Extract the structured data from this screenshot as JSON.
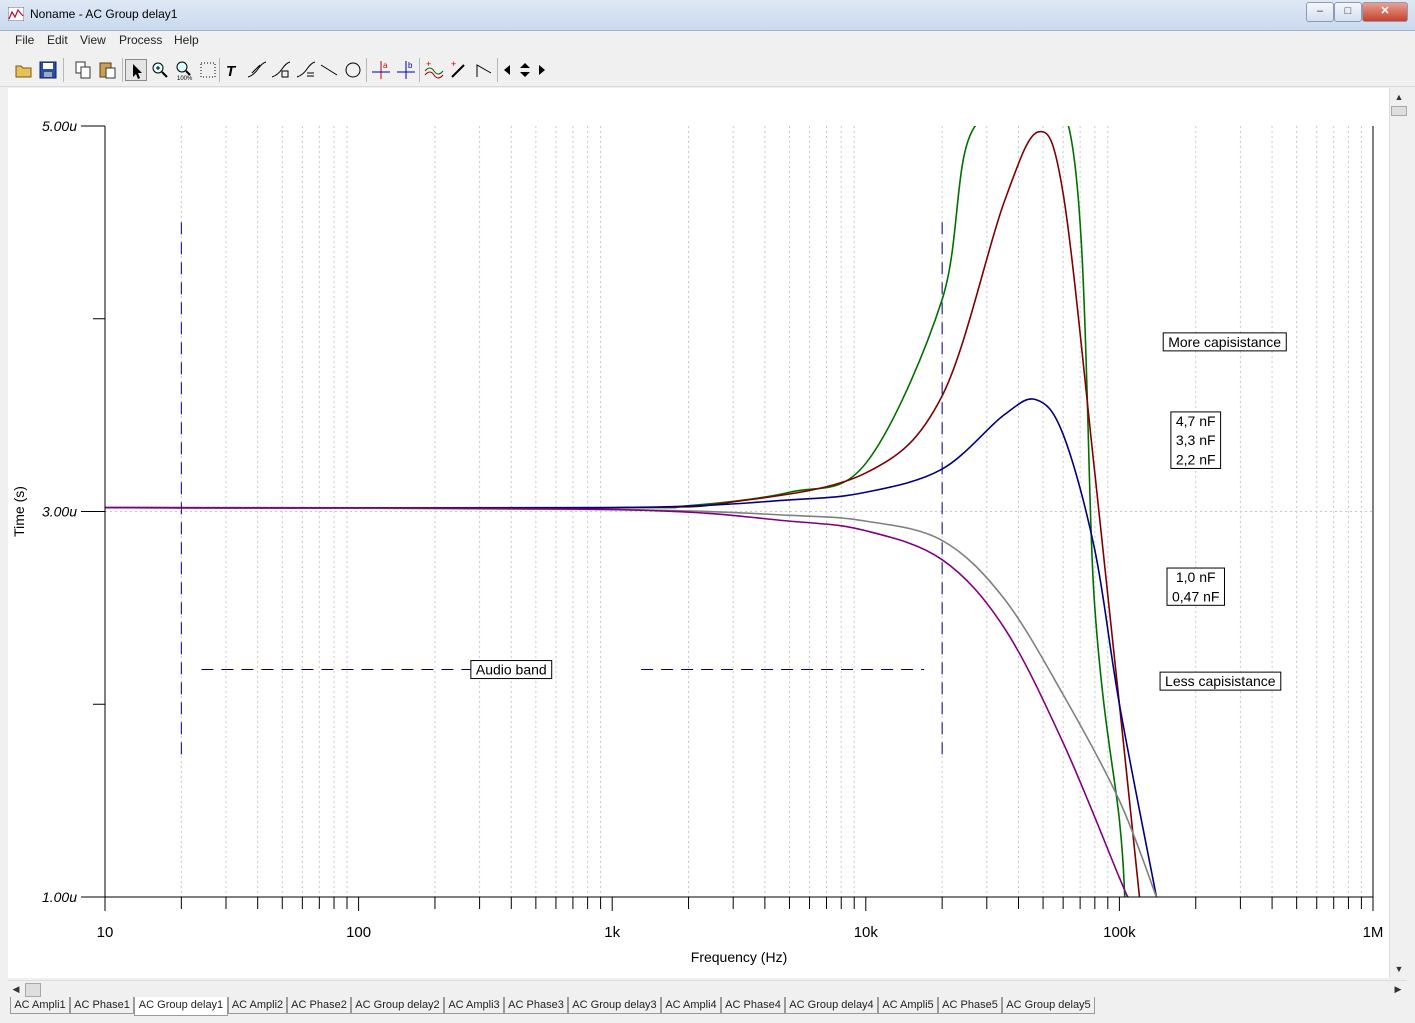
{
  "window": {
    "title": "Noname - AC Group delay1",
    "minimize_glyph": "–",
    "maximize_glyph": "□",
    "close_glyph": "✕"
  },
  "menu": [
    {
      "label": "File"
    },
    {
      "label": "Edit"
    },
    {
      "label": "View"
    },
    {
      "label": "Process"
    },
    {
      "label": "Help"
    }
  ],
  "toolbar": {
    "icons": [
      "open-folder-icon",
      "save-icon",
      "copy-icon",
      "paste-icon",
      "pointer-icon",
      "zoom-in-icon",
      "zoom-100-icon",
      "select-area-icon",
      "text-icon",
      "curve-label-icon",
      "curve-label-2-icon",
      "curve-label-3-icon",
      "line-icon",
      "circle-icon",
      "cursor-a-icon",
      "cursor-b-icon",
      "curve-tools-icon",
      "pen-icon",
      "polyline-icon",
      "arrow-left-icon",
      "arrow-up-down-icon",
      "arrow-right-icon"
    ]
  },
  "chart_data": {
    "type": "line",
    "x_scale": "log",
    "xlabel": "Frequency (Hz)",
    "ylabel": "Time (s)",
    "xlim": [
      10,
      1000000
    ],
    "ylim": [
      1.0,
      5.0
    ],
    "x_tick_labels": [
      "10",
      "100",
      "1k",
      "10k",
      "100k",
      "1M"
    ],
    "x_tick_values": [
      10,
      100,
      1000,
      10000,
      100000,
      1000000
    ],
    "y_tick_labels": [
      "5.00u",
      "3.00u",
      "1.00u"
    ],
    "y_tick_values": [
      5.0,
      3.0,
      1.0
    ],
    "y_unit": "u",
    "grid": "log-minor dotted vertical, dotted horizontal at 3.00u",
    "series": [
      {
        "color": "#007000",
        "points": [
          [
            10,
            3.02
          ],
          [
            1000,
            3.02
          ],
          [
            2000,
            3.03
          ],
          [
            5000,
            3.1
          ],
          [
            10000,
            3.25
          ],
          [
            20000,
            4.1
          ],
          [
            27000,
            5.0
          ],
          [
            63000,
            5.0
          ],
          [
            80000,
            2.5
          ],
          [
            100000,
            1.4
          ],
          [
            105000,
            1.0
          ]
        ]
      },
      {
        "color": "#800000",
        "points": [
          [
            10,
            3.02
          ],
          [
            1000,
            3.02
          ],
          [
            3000,
            3.05
          ],
          [
            10000,
            3.2
          ],
          [
            20000,
            3.6
          ],
          [
            35000,
            4.6
          ],
          [
            48000,
            4.97
          ],
          [
            60000,
            4.65
          ],
          [
            80000,
            3.2
          ],
          [
            100000,
            2.0
          ],
          [
            120000,
            1.0
          ]
        ]
      },
      {
        "color": "#000080",
        "points": [
          [
            10,
            3.02
          ],
          [
            1000,
            3.02
          ],
          [
            5000,
            3.06
          ],
          [
            10000,
            3.1
          ],
          [
            20000,
            3.22
          ],
          [
            35000,
            3.5
          ],
          [
            47000,
            3.58
          ],
          [
            60000,
            3.4
          ],
          [
            80000,
            2.8
          ],
          [
            100000,
            2.0
          ],
          [
            140000,
            1.0
          ]
        ]
      },
      {
        "color": "#808080",
        "points": [
          [
            10,
            3.02
          ],
          [
            1000,
            3.01
          ],
          [
            5000,
            2.98
          ],
          [
            10000,
            2.95
          ],
          [
            20000,
            2.85
          ],
          [
            35000,
            2.55
          ],
          [
            60000,
            2.05
          ],
          [
            100000,
            1.5
          ],
          [
            140000,
            1.0
          ]
        ]
      },
      {
        "color": "#800080",
        "points": [
          [
            10,
            3.02
          ],
          [
            1000,
            3.01
          ],
          [
            5000,
            2.95
          ],
          [
            10000,
            2.9
          ],
          [
            20000,
            2.75
          ],
          [
            35000,
            2.4
          ],
          [
            60000,
            1.8
          ],
          [
            100000,
            1.1
          ],
          [
            108000,
            1.0
          ]
        ]
      }
    ],
    "audio_band_lines": {
      "x": [
        20,
        20000
      ],
      "y_range": [
        1.7,
        4.5
      ],
      "color": "#000080"
    },
    "annotations": [
      {
        "text": "Audio band",
        "x": 400,
        "y": 2.18
      },
      {
        "text": "More capisistance",
        "x": 260000,
        "y": 3.88
      },
      {
        "text": "4,7 nF",
        "x": 200000,
        "y": 3.47
      },
      {
        "text": "3,3 nF",
        "x": 200000,
        "y": 3.37
      },
      {
        "text": "2,2 nF",
        "x": 200000,
        "y": 3.27
      },
      {
        "text": "1,0 nF",
        "x": 200000,
        "y": 2.66
      },
      {
        "text": "0,47 nF",
        "x": 200000,
        "y": 2.56
      },
      {
        "text": "Less capisistance",
        "x": 250000,
        "y": 2.12
      }
    ]
  },
  "tabs": [
    {
      "label": "AC Ampli1"
    },
    {
      "label": "AC Phase1"
    },
    {
      "label": "AC Group delay1",
      "active": true
    },
    {
      "label": "AC Ampli2"
    },
    {
      "label": "AC Phase2"
    },
    {
      "label": "AC Group delay2"
    },
    {
      "label": "AC Ampli3"
    },
    {
      "label": "AC Phase3"
    },
    {
      "label": "AC Group delay3"
    },
    {
      "label": "AC Ampli4"
    },
    {
      "label": "AC Phase4"
    },
    {
      "label": "AC Group delay4"
    },
    {
      "label": "AC Ampli5"
    },
    {
      "label": "AC Phase5"
    },
    {
      "label": "AC Group delay5"
    }
  ]
}
